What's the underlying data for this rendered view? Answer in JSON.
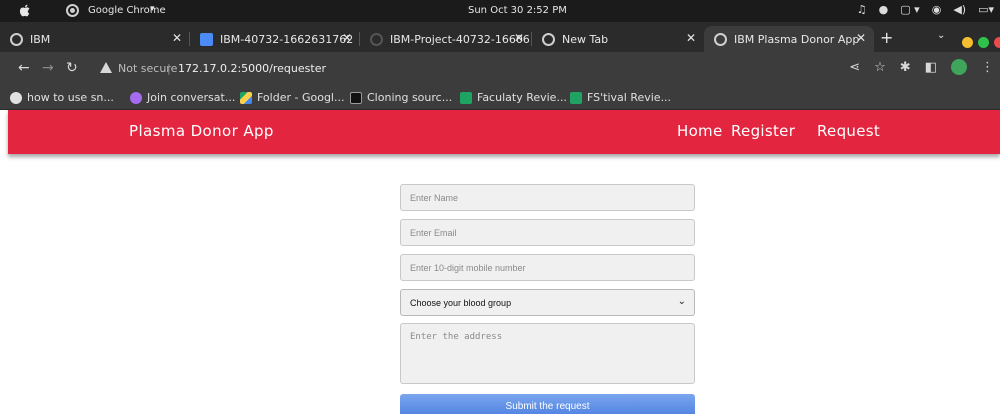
{
  "os": {
    "app_name": "Google Chrome",
    "clock": "Sun Oct 30  2:52 PM"
  },
  "tabs": [
    {
      "label": "IBM",
      "active": false
    },
    {
      "label": "IBM-40732-1662631762",
      "active": false
    },
    {
      "label": "IBM-Project-40732-16606",
      "active": false
    },
    {
      "label": "New Tab",
      "active": false
    },
    {
      "label": "IBM Plasma Donor App",
      "active": true
    }
  ],
  "address_bar": {
    "security_label": "Not secure",
    "url": "172.17.0.2:5000/requester"
  },
  "bookmarks": [
    {
      "label": "how to use sn...",
      "icon": "github-icon"
    },
    {
      "label": "Join conversat...",
      "icon": "chat-icon"
    },
    {
      "label": "Folder - Googl...",
      "icon": "drive-icon"
    },
    {
      "label": "Cloning sourc...",
      "icon": "dev-icon"
    },
    {
      "label": "Faculaty Revie...",
      "icon": "sheet-icon"
    },
    {
      "label": "FS'tival Revie...",
      "icon": "sheet-icon"
    }
  ],
  "app": {
    "brand": "Plasma Donor App",
    "nav": [
      "Home",
      "Register",
      "Request"
    ],
    "accent_color": "#e4253f"
  },
  "form": {
    "name_placeholder": "Enter Name",
    "email_placeholder": "Enter Email",
    "mobile_placeholder": "Enter 10-digit mobile number",
    "blood_group_selected": "Choose your blood group",
    "address_placeholder": "Enter the address",
    "submit_label": "Submit the request"
  }
}
